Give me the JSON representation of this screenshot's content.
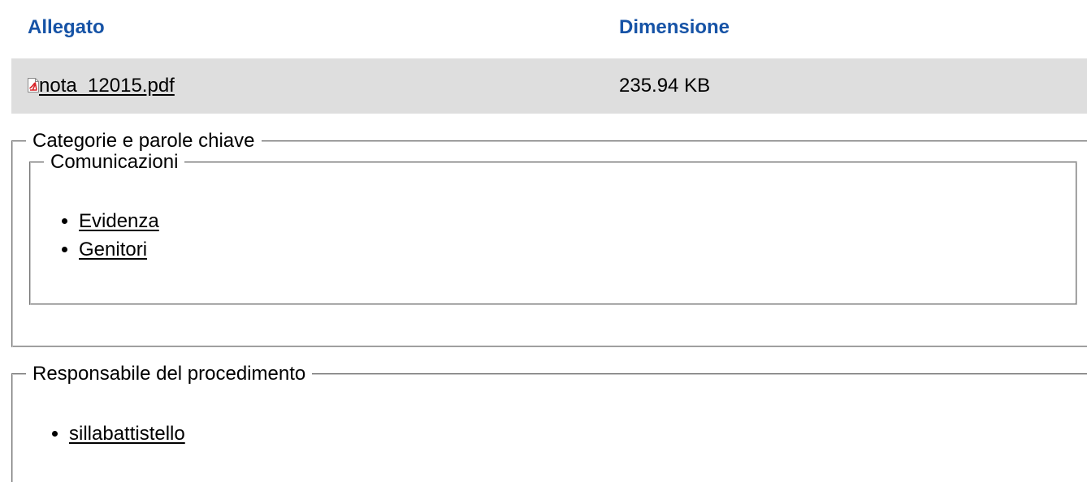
{
  "attachments": {
    "headers": {
      "file": "Allegato",
      "size": "Dimensione"
    },
    "rows": [
      {
        "icon": "pdf-file-icon",
        "name": "nota_12015.pdf",
        "size": "235.94 KB"
      }
    ]
  },
  "taxonomy": {
    "legend": "Categorie e parole chiave",
    "groups": [
      {
        "legend": "Comunicazioni",
        "terms": [
          "Evidenza",
          "Genitori"
        ]
      }
    ]
  },
  "responsible": {
    "legend": "Responsabile del procedimento",
    "terms": [
      "sillabattistello"
    ]
  },
  "colors": {
    "header_text": "#1653a6",
    "row_background": "#dedede",
    "pdf_icon_red": "#d8252a"
  }
}
